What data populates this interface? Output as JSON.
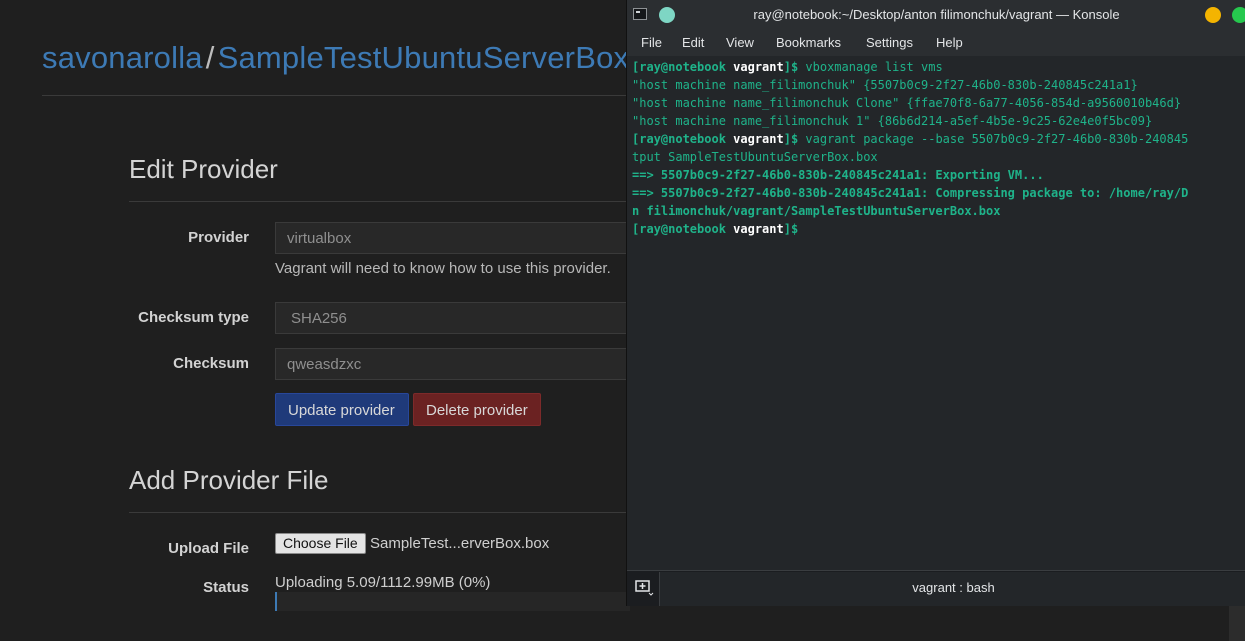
{
  "web": {
    "breadcrumb": {
      "user": "savonarolla",
      "separator": "/",
      "box": "SampleTestUbuntuServerBox"
    },
    "edit_provider": {
      "title": "Edit Provider",
      "provider_label": "Provider",
      "provider_value": "virtualbox",
      "provider_help": "Vagrant will need to know how to use this provider.",
      "checksum_type_label": "Checksum type",
      "checksum_type_value": "SHA256",
      "checksum_label": "Checksum",
      "checksum_value": "qweasdzxc",
      "update_button": "Update provider",
      "delete_button": "Delete provider"
    },
    "add_provider_file": {
      "title": "Add Provider File",
      "upload_label": "Upload File",
      "choose_file_button": "Choose File",
      "file_name": "SampleTest...erverBox.box",
      "status_label": "Status",
      "status_text": "Uploading 5.09/1112.99MB (0%)",
      "progress_percent": 0.5
    },
    "colors": {
      "link": "#3d7ab5",
      "update": "#1f3a7a",
      "delete": "#6b2222"
    }
  },
  "konsole": {
    "title": "ray@notebook:~/Desktop/anton filimonchuk/vagrant — Konsole",
    "menu": [
      "File",
      "Edit",
      "View",
      "Bookmarks",
      "Settings",
      "Help"
    ],
    "prompt_user": "[ray@notebook",
    "prompt_dir": "vagrant",
    "prompt_end": "]$",
    "lines": {
      "cmd1": " vboxmanage list vms",
      "out1": "\"host machine name_filimonchuk\" {5507b0c9-2f27-46b0-830b-240845c241a1}",
      "out2": "\"host machine name_filimonchuk Clone\" {ffae70f8-6a77-4056-854d-a9560010b46d}",
      "out3": "\"host machine name_filimonchuk 1\" {86b6d214-a5ef-4b5e-9c25-62e4e0f5bc09}",
      "cmd2": " vagrant package --base 5507b0c9-2f27-46b0-830b-240845",
      "cmd2_wrap": "tput SampleTestUbuntuServerBox.box",
      "out4": "==> 5507b0c9-2f27-46b0-830b-240845c241a1: Exporting VM...",
      "out5": "==> 5507b0c9-2f27-46b0-830b-240845c241a1: Compressing package to: /home/ray/D",
      "out5_wrap": "n filimonchuk/vagrant/SampleTestUbuntuServerBox.box"
    },
    "tab_label": "vagrant : bash",
    "colors": {
      "green": "#1fb38a",
      "background": "#232629"
    }
  }
}
